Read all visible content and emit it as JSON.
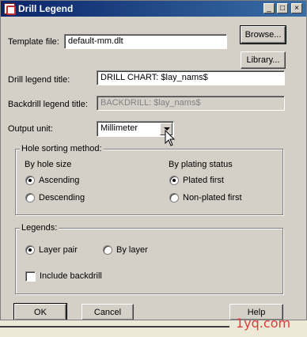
{
  "window": {
    "title": "Drill Legend",
    "minimize_glyph": "_",
    "maximize_glyph": "□",
    "close_glyph": "×"
  },
  "template_file": {
    "label": "Template file:",
    "value": "default-mm.dlt",
    "browse_label": "Browse...",
    "library_label": "Library..."
  },
  "drill_legend_title": {
    "label": "Drill legend title:",
    "value": "DRILL CHART: $lay_nams$"
  },
  "backdrill_legend_title": {
    "label": "Backdrill legend title:",
    "value": "BACKDRILL: $lay_nams$"
  },
  "output_unit": {
    "label": "Output unit:",
    "value": "Millimeter"
  },
  "hole_sorting": {
    "title": "Hole sorting method:",
    "by_size_label": "By hole size",
    "ascending": "Ascending",
    "descending": "Descending",
    "by_plating_label": "By plating status",
    "plated_first": "Plated first",
    "non_plated_first": "Non-plated first",
    "size_selected": "Ascending",
    "plating_selected": "Plated first"
  },
  "legends": {
    "title": "Legends:",
    "layer_pair": "Layer pair",
    "by_layer": "By layer",
    "include_backdrill": "Include backdrill",
    "selected": "Layer pair",
    "include_backdrill_checked": false
  },
  "buttons": {
    "ok": "OK",
    "cancel": "Cancel",
    "help": "Help"
  },
  "watermark": "1yq.com",
  "colors": {
    "titlebar": "#0a246a",
    "dialog_face": "#d4d0c8",
    "watermark": "#e03a3a"
  }
}
